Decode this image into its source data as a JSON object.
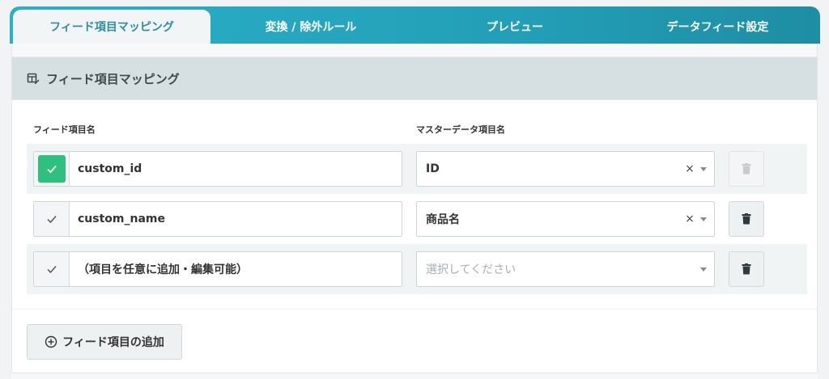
{
  "tabs": [
    {
      "label": "フィード項目マッピング",
      "active": true
    },
    {
      "label": "変換 / 除外ルール",
      "active": false
    },
    {
      "label": "プレビュー",
      "active": false
    },
    {
      "label": "データフィード設定",
      "active": false
    }
  ],
  "section": {
    "title": "フィード項目マッピング",
    "icon": "table-edit-icon"
  },
  "columns": {
    "feed_item": "フィード項目名",
    "master_item": "マスターデータ項目名"
  },
  "rows": [
    {
      "checked": true,
      "field": "custom_id",
      "mapping": "ID",
      "clearable": true,
      "delete_enabled": false
    },
    {
      "checked": false,
      "field": "custom_name",
      "mapping": "商品名",
      "clearable": true,
      "delete_enabled": true
    },
    {
      "checked": false,
      "field": "（項目を任意に追加・編集可能）",
      "mapping_placeholder": "選択してください",
      "clearable": false,
      "delete_enabled": true
    }
  ],
  "clear_glyph": "×",
  "add_button": {
    "label": "フィード項目の追加",
    "icon": "plus-circle-icon"
  },
  "colors": {
    "tab_gradient_start": "#2bb0c9",
    "tab_active_text": "#2a8fa6",
    "check_on": "#2ec07e",
    "header_bg": "#d6dfe2"
  }
}
